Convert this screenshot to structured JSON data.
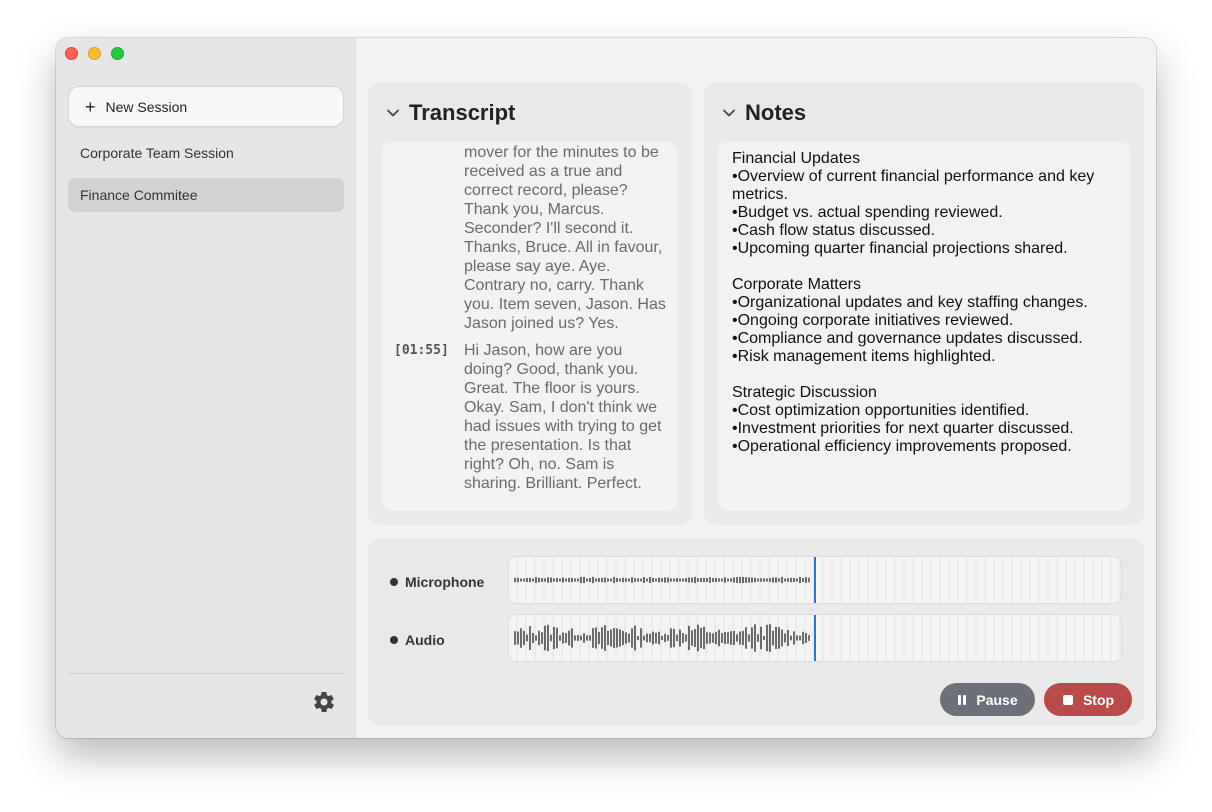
{
  "sidebar": {
    "new_session_label": "New Session",
    "sessions": [
      {
        "label": "Corporate Team Session"
      },
      {
        "label": "Finance Commitee"
      }
    ]
  },
  "transcript": {
    "title": "Transcript",
    "entries": [
      {
        "timestamp": "",
        "text": "that change, could I have a mover for the minutes to be received as a true and correct record, please? Thank you, Marcus. Seconder? I'll second it. Thanks, Bruce. All in favour, please say aye. Aye. Contrary no, carry. Thank you. Item seven, Jason. Has Jason joined us? Yes."
      },
      {
        "timestamp": "[01:55]",
        "text": "Hi Jason, how are you doing? Good, thank you. Great. The floor is yours. Okay. Sam, I don't think we had issues with trying to get the presentation. Is that right? Oh, no. Sam is sharing. Brilliant. Perfect."
      }
    ]
  },
  "notes": {
    "title": "Notes",
    "sections": [
      {
        "heading": "Financial Updates",
        "bullets": [
          "•Overview of current financial performance and key metrics.",
          "•Budget vs. actual spending reviewed.",
          "•Cash flow status discussed.",
          "•Upcoming quarter financial projections shared."
        ]
      },
      {
        "heading": "Corporate Matters",
        "bullets": [
          "•Organizational updates and key staffing changes.",
          "•Ongoing corporate initiatives reviewed.",
          "•Compliance and governance updates discussed.",
          "•Risk management items highlighted."
        ]
      },
      {
        "heading": "Strategic Discussion",
        "bullets": [
          "•Cost optimization opportunities identified.",
          "•Investment priorities for next quarter discussed.",
          "•Operational efficiency improvements proposed."
        ]
      }
    ]
  },
  "audio": {
    "tracks": [
      {
        "label": "Microphone"
      },
      {
        "label": "Audio"
      }
    ],
    "playhead_fraction": 0.5,
    "pause_label": "Pause",
    "stop_label": "Stop"
  },
  "colors": {
    "playhead": "#2f6fe8",
    "stop_button": "#b94a4a",
    "pause_button": "#6d7079",
    "selected_session": "#d2d2d2"
  },
  "icons": {
    "new_session": "plus-icon",
    "settings": "gear-icon",
    "collapse": "chevron-down-icon",
    "track": "dot-icon",
    "pause": "pause-icon",
    "stop": "stop-icon"
  }
}
